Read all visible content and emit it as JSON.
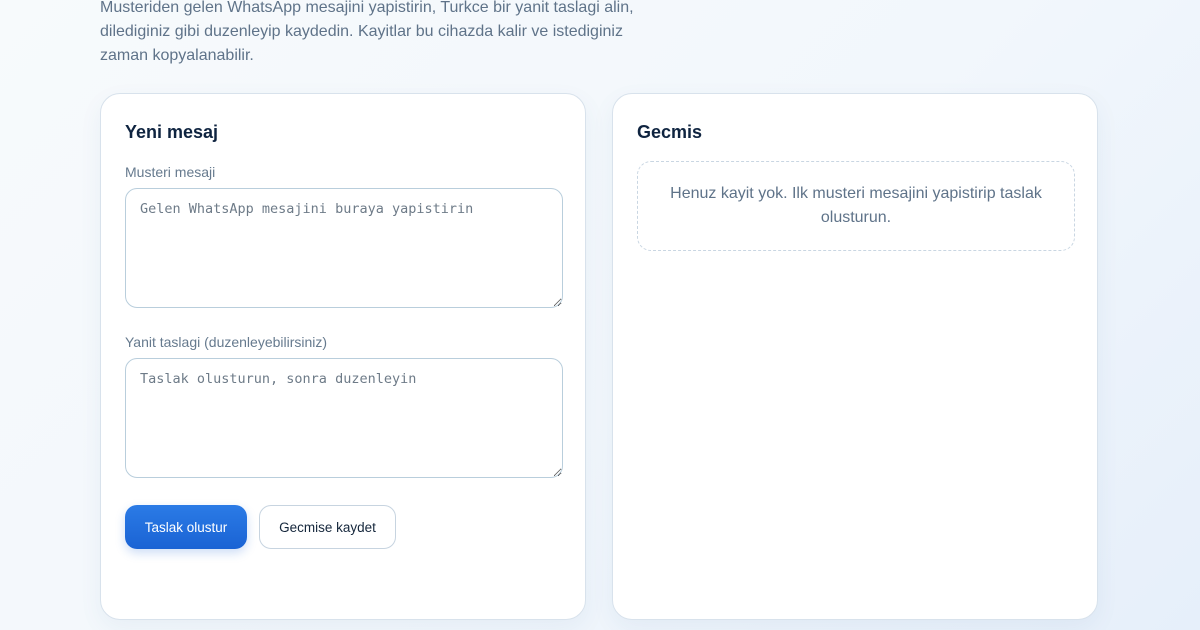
{
  "intro": {
    "text": "Musteriden gelen WhatsApp mesajini yapistirin, Turkce bir yanit taslagi alin, dilediginiz gibi duzenleyip kaydedin. Kayitlar bu cihazda kalir ve istediginiz zaman kopyalanabilir."
  },
  "new_message": {
    "title": "Yeni mesaj",
    "customer_label": "Musteri mesaji",
    "customer_placeholder": "Gelen WhatsApp mesajini buraya yapistirin",
    "customer_value": "",
    "draft_label": "Yanit taslagi (duzenleyebilirsiniz)",
    "draft_placeholder": "Taslak olusturun, sonra duzenleyin",
    "draft_value": "",
    "generate_button": "Taslak olustur",
    "save_button": "Gecmise kaydet"
  },
  "history": {
    "title": "Gecmis",
    "empty_text": "Henuz kayit yok. Ilk musteri mesajini yapistirip taslak olusturun."
  },
  "colors": {
    "accent": "#1f6fde",
    "text_dark": "#0f2440",
    "text_muted": "#5f7389"
  }
}
